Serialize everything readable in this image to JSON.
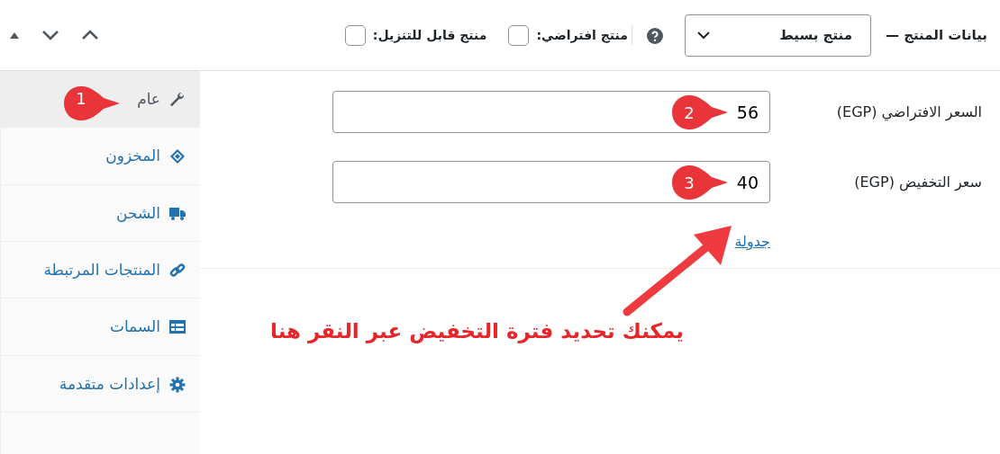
{
  "header": {
    "title": "بيانات المنتج —",
    "product_type": "منتج بسيط",
    "options": [
      {
        "label": "منتج افتراضي:",
        "checked": false
      },
      {
        "label": "منتج قابل للتنزيل:",
        "checked": false
      }
    ]
  },
  "tabs": [
    {
      "label": "عام",
      "kind": "wrench",
      "selected": true
    },
    {
      "label": "المخزون",
      "kind": "inventory",
      "selected": false
    },
    {
      "label": "الشحن",
      "kind": "truck",
      "selected": false
    },
    {
      "label": "المنتجات المرتبطة",
      "kind": "link",
      "selected": false
    },
    {
      "label": "السمات",
      "kind": "table",
      "selected": false
    },
    {
      "label": "إعدادات متقدمة",
      "kind": "gear",
      "selected": false
    }
  ],
  "fields": [
    {
      "label": "السعر الافتراضي (EGP)",
      "value": "56"
    },
    {
      "label": "سعر التخفيض (EGP)",
      "value": "40"
    }
  ],
  "schedule_link": "جدولة",
  "annotations": {
    "callouts": [
      "1",
      "2",
      "3"
    ],
    "note": "يمكنك تحديد فترة التخفيض عبر النقر هنا"
  }
}
